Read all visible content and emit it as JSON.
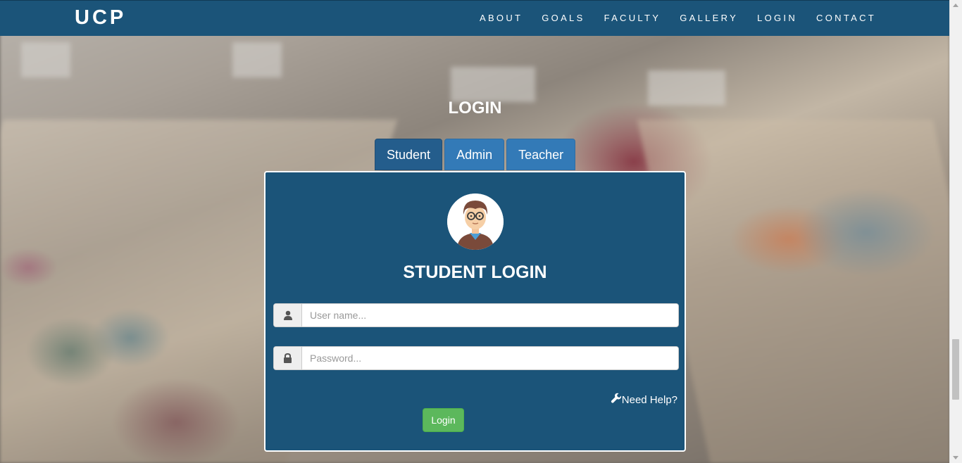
{
  "brand": "UCP",
  "nav": {
    "items": [
      "ABOUT",
      "GOALS",
      "FACULTY",
      "GALLERY",
      "LOGIN",
      "CONTACT"
    ]
  },
  "login_heading": "LOGIN",
  "tabs": [
    {
      "label": "Student",
      "active": true
    },
    {
      "label": "Admin",
      "active": false
    },
    {
      "label": "Teacher",
      "active": false
    }
  ],
  "panel": {
    "avatar_icon": "student-avatar-icon",
    "title": "STUDENT LOGIN",
    "username": {
      "placeholder": "User name...",
      "value": "",
      "icon": "user-icon"
    },
    "password": {
      "placeholder": "Password...",
      "value": "",
      "icon": "lock-icon"
    },
    "help_text": "Need Help?",
    "help_icon": "wrench-icon",
    "login_button": "Login"
  },
  "colors": {
    "navbar": "#1b5479",
    "panel": "#1b5479",
    "tab": "#337ab7",
    "tab_active": "#245d8c",
    "login_button": "#5cb85c"
  }
}
